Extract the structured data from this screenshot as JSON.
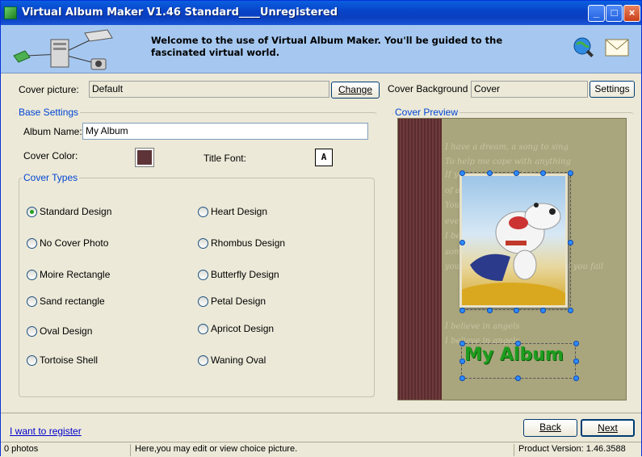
{
  "window": {
    "title": "Virtual Album Maker V1.46 Standard____Unregistered",
    "minimize": "_",
    "maximize": "□",
    "close": "×"
  },
  "banner": {
    "welcome": "Welcome to the use of Virtual Album Maker. You'll be guided to the fascinated virtual world."
  },
  "cover_picture": {
    "label": "Cover picture:",
    "value": "Default",
    "button": "Change"
  },
  "cover_background": {
    "label": "Cover Background",
    "value": "Cover",
    "button": "Settings"
  },
  "base_settings": {
    "title": "Base Settings",
    "album_name_label": "Album Name:",
    "album_name_value": "My Album",
    "cover_color_label": "Cover Color:",
    "cover_color": "#5e3438",
    "title_font_label": "Title Font:",
    "title_font_glyph": "A"
  },
  "cover_types": {
    "title": "Cover Types",
    "options": [
      {
        "label": "Standard Design",
        "selected": true
      },
      {
        "label": "Heart Design",
        "selected": false
      },
      {
        "label": "No Cover Photo",
        "selected": false
      },
      {
        "label": "Rhombus Design",
        "selected": false
      },
      {
        "label": "Moire Rectangle",
        "selected": false
      },
      {
        "label": "Butterfly Design",
        "selected": false
      },
      {
        "label": "Sand rectangle",
        "selected": false
      },
      {
        "label": "Petal Design",
        "selected": false
      },
      {
        "label": "Oval Design",
        "selected": false
      },
      {
        "label": "Apricot Design",
        "selected": false
      },
      {
        "label": "Tortoise Shell",
        "selected": false
      },
      {
        "label": "Waning Oval",
        "selected": false
      }
    ]
  },
  "preview": {
    "title": "Cover Preview",
    "album_title": "My Album",
    "script_lines": [
      "I have a dream, a song to sing",
      "To help me cope with anything",
      "If you see the wonder",
      "of a fairy tale",
      "You can take the future",
      "even if you fail",
      "I believe in angels",
      "something good in everything",
      "you can take the future even if you fail",
      "I believe in angels",
      "I believe in angels"
    ]
  },
  "footer": {
    "register_link": "I want to register",
    "back": "Back",
    "next": "Next"
  },
  "status": {
    "photos": "0 photos",
    "hint": "Here,you may edit or view choice picture.",
    "version": "Product Version:  1.46.3588"
  }
}
